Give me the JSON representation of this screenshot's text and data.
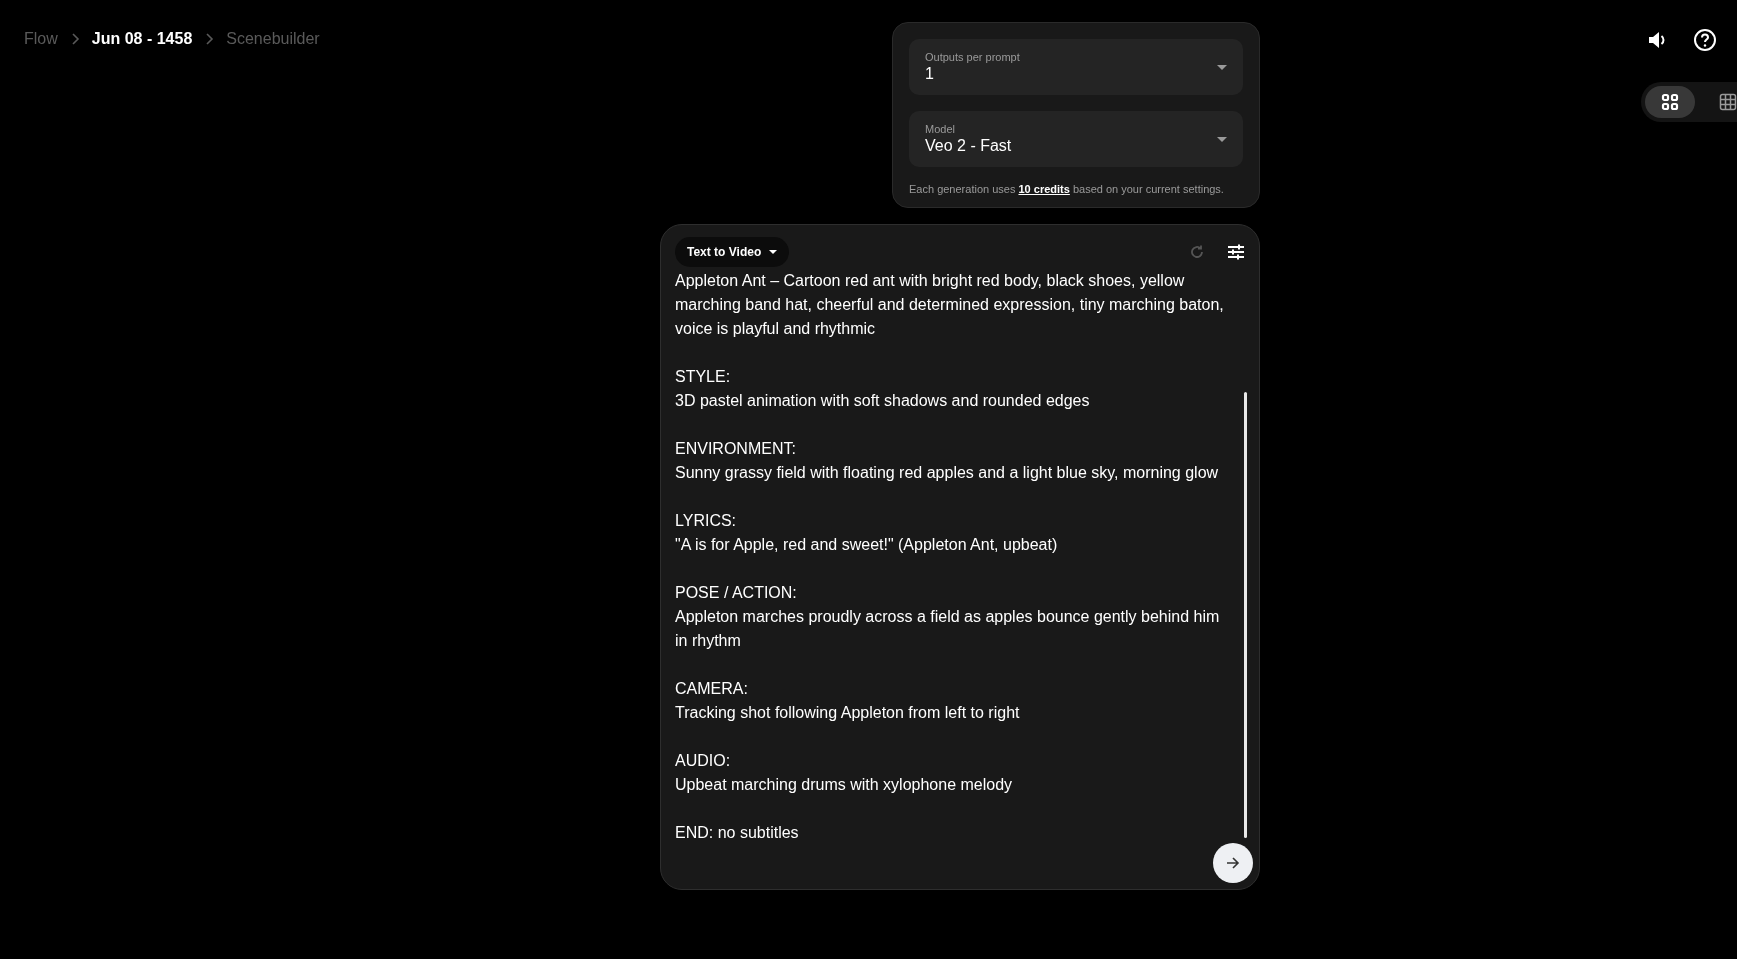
{
  "breadcrumbs": [
    {
      "label": "Flow",
      "selected": false
    },
    {
      "label": "Jun 08 - 1458",
      "selected": true
    },
    {
      "label": "Scenebuilder",
      "selected": false
    }
  ],
  "settings": {
    "fields": [
      {
        "label": "Outputs per prompt",
        "value": "1"
      },
      {
        "label": "Model",
        "value": "Veo 2 - Fast"
      }
    ],
    "note": {
      "before": "Each generation uses ",
      "link": "10 credits",
      "after": " based on your current settings."
    }
  },
  "view_toggle": [
    {
      "kind": "cards",
      "selected": true
    },
    {
      "kind": "grid",
      "selected": false
    }
  ],
  "prompt": {
    "mode": "Text to Video",
    "blocks": [
      [
        "Appleton Ant – Cartoon red ant with bright red body, black shoes, yellow marching band hat, cheerful and determined expression, tiny marching baton, voice is playful and rhythmic"
      ],
      [
        "STYLE:",
        "3D pastel animation with soft shadows and rounded edges"
      ],
      [
        "ENVIRONMENT:",
        "Sunny grassy field with floating red apples and a light blue sky, morning glow"
      ],
      [
        "LYRICS:",
        "\"A is for Apple, red and sweet!\" (Appleton Ant, upbeat)"
      ],
      [
        "POSE / ACTION:",
        "Appleton marches proudly across a field as apples bounce gently behind him in rhythm"
      ],
      [
        "CAMERA:",
        "Tracking shot following Appleton from left to right"
      ],
      [
        "AUDIO:",
        "Upbeat marching drums with xylophone melody"
      ],
      [
        "END: no subtitles"
      ]
    ]
  }
}
